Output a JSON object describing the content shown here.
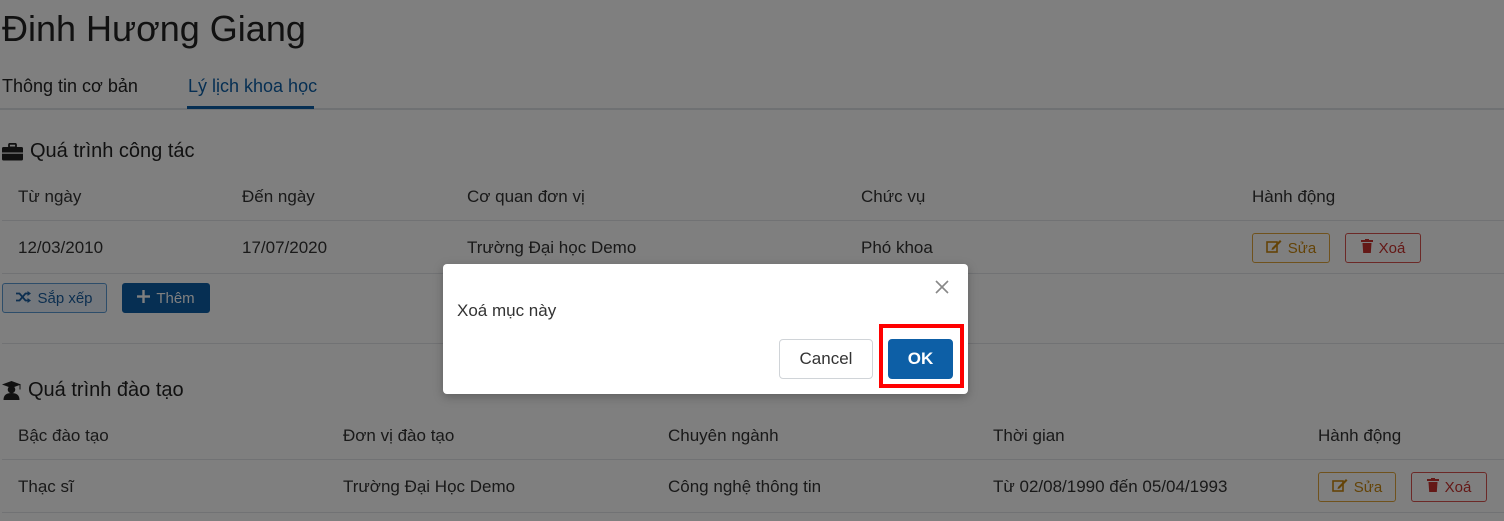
{
  "profile": {
    "name": "Đinh Hương Giang"
  },
  "tabs": [
    {
      "label": "Thông tin cơ bản",
      "active": false
    },
    {
      "label": "Lý lịch khoa học",
      "active": true
    }
  ],
  "work": {
    "title": "Quá trình công tác",
    "icon": "briefcase-icon",
    "columns": [
      "Từ ngày",
      "Đến ngày",
      "Cơ quan đơn vị",
      "Chức vụ",
      "Hành động"
    ],
    "rows": [
      {
        "from": "12/03/2010",
        "to": "17/07/2020",
        "org": "Trường Đại học Demo",
        "position": "Phó khoa"
      }
    ],
    "edit_label": "Sửa",
    "delete_label": "Xoá",
    "sort_label": "Sắp xếp",
    "add_label": "Thêm"
  },
  "education": {
    "title": "Quá trình đào tạo",
    "icon": "graduate-icon",
    "columns": [
      "Bậc đào tạo",
      "Đơn vị đào tạo",
      "Chuyên ngành",
      "Thời gian",
      "Hành động"
    ],
    "rows": [
      {
        "level": "Thạc sĩ",
        "unit": "Trường Đại Học Demo",
        "major": "Công nghệ thông tin",
        "time": "Từ 02/08/1990 đến 05/04/1993"
      }
    ],
    "edit_label": "Sửa",
    "delete_label": "Xoá"
  },
  "dialog": {
    "message": "Xoá mục này",
    "cancel_label": "Cancel",
    "ok_label": "OK"
  },
  "colors": {
    "primary": "#0d5fa6",
    "warning": "#e0a53a",
    "danger": "#d9534f",
    "highlight": "#ff0000"
  }
}
